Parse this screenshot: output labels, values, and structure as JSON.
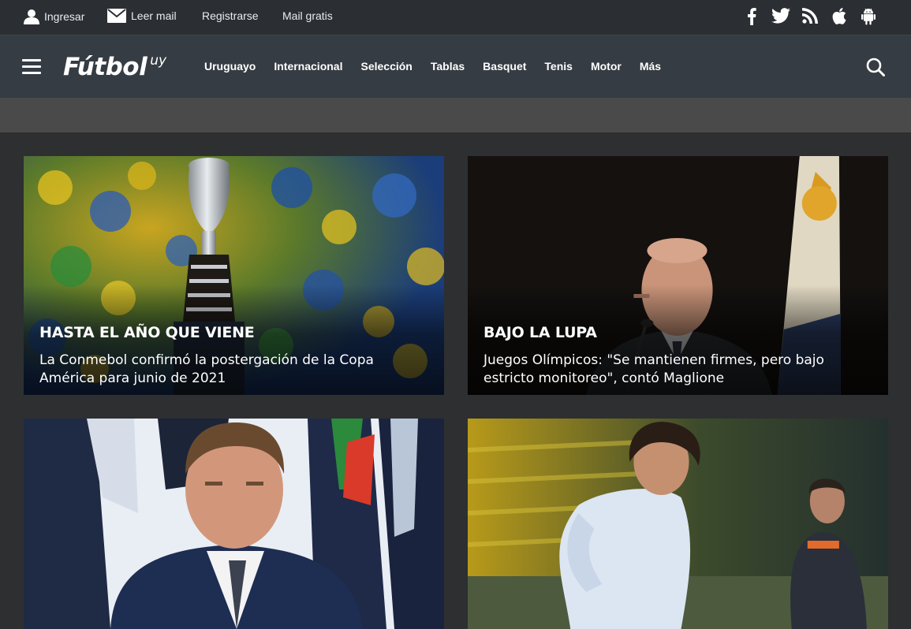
{
  "topbar": {
    "ingresar": "Ingresar",
    "leer_mail": "Leer mail",
    "registrarse": "Registrarse",
    "mail_gratis": "Mail gratis",
    "social_icons": [
      "facebook-icon",
      "twitter-icon",
      "rss-icon",
      "apple-icon",
      "android-icon"
    ]
  },
  "nav": {
    "logo_main": "Fútbol",
    "logo_sub": "uy",
    "items": [
      "Uruguayo",
      "Internacional",
      "Selección",
      "Tablas",
      "Basquet",
      "Tenis",
      "Motor",
      "Más"
    ]
  },
  "articles": [
    {
      "kicker": "HASTA EL AÑO QUE VIENE",
      "headline": "La Conmebol confirmó la postergación de la Copa América para junio de 2021"
    },
    {
      "kicker": "BAJO LA LUPA",
      "headline": "Juegos Olímpicos: \"Se mantienen firmes, pero bajo estricto monitoreo\", contó Maglione"
    }
  ],
  "colors": {
    "topbar_bg": "#2b2e33",
    "navbar_bg": "#353c43",
    "ad_strip_bg": "#4a4a4a",
    "page_bg": "#2d2f31"
  }
}
